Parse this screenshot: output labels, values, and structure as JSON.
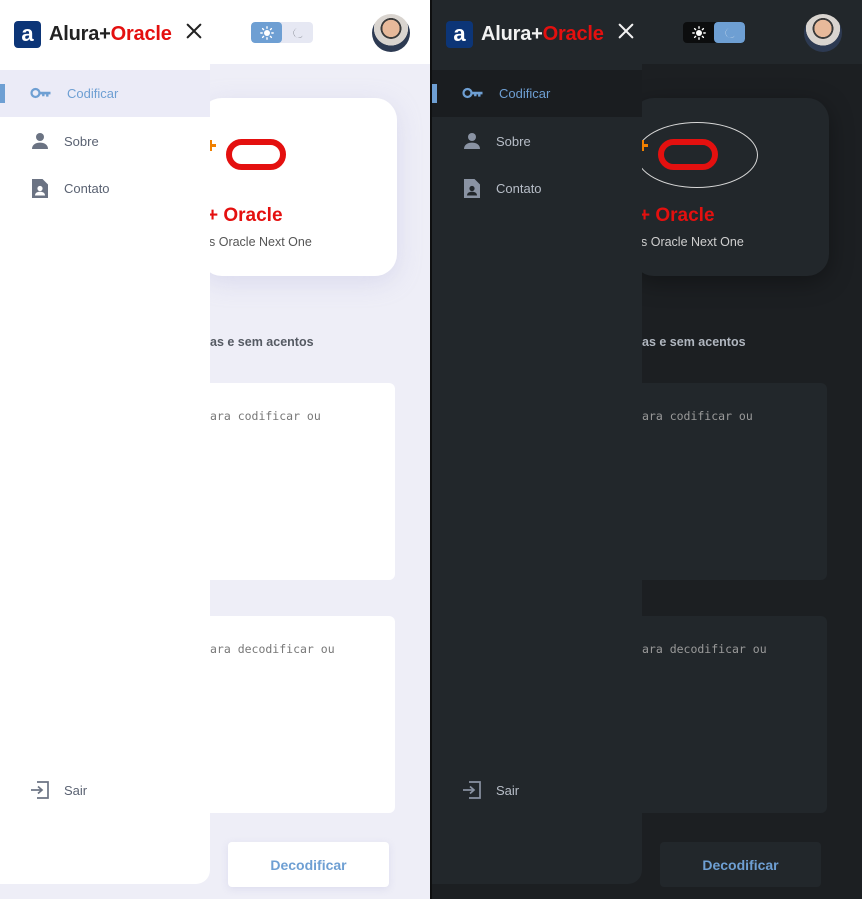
{
  "app": {
    "brand_part1": "Alura+",
    "brand_part2": "Oracle",
    "logo_letter": "a"
  },
  "nav": {
    "items": [
      {
        "label": "Codificar",
        "icon": "key-icon",
        "active": true
      },
      {
        "label": "Sobre",
        "icon": "person-icon",
        "active": false
      },
      {
        "label": "Contato",
        "icon": "contact-card-icon",
        "active": false
      }
    ],
    "logout_label": "Sair",
    "logout_icon": "logout-icon"
  },
  "card": {
    "title": "+ Oracle",
    "subtitle": "s Oracle Next One"
  },
  "main": {
    "hint": "as e sem acentos",
    "encode_placeholder": "ara codificar ou",
    "decode_placeholder": "ara decodificar ou",
    "decode_button": "Decodificar"
  },
  "themes": [
    "light",
    "dark"
  ],
  "colors": {
    "accent": "#6e9fd3",
    "oracle_red": "#e4100f",
    "plus_orange": "#f08000",
    "logo_blue": "#0c3577"
  }
}
